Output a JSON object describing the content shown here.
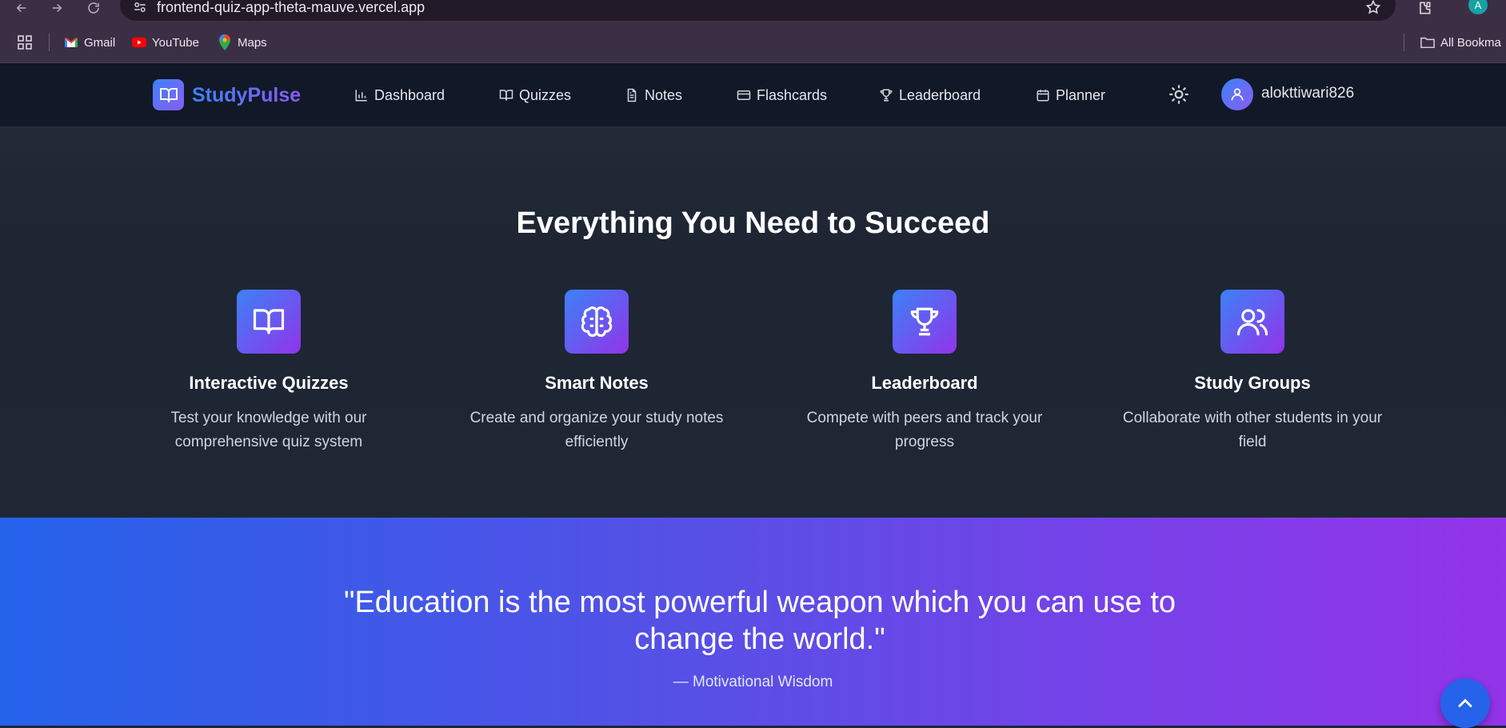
{
  "browser": {
    "url": "frontend-quiz-app-theta-mauve.vercel.app",
    "profile_initial": "A",
    "bookmarks": [
      {
        "label": "Gmail",
        "icon": "gmail-icon"
      },
      {
        "label": "YouTube",
        "icon": "youtube-icon"
      },
      {
        "label": "Maps",
        "icon": "maps-icon"
      }
    ],
    "all_bookmarks_label": "All Bookma"
  },
  "navbar": {
    "brand": "StudyPulse",
    "items": [
      {
        "label": "Dashboard",
        "icon": "bar-chart-icon"
      },
      {
        "label": "Quizzes",
        "icon": "open-book-icon"
      },
      {
        "label": "Notes",
        "icon": "file-text-icon"
      },
      {
        "label": "Flashcards",
        "icon": "credit-card-icon"
      },
      {
        "label": "Leaderboard",
        "icon": "trophy-icon"
      },
      {
        "label": "Planner",
        "icon": "calendar-icon"
      }
    ],
    "theme_icon": "sun-icon",
    "username": "alokttiwari826"
  },
  "features": {
    "title": "Everything You Need to Succeed",
    "items": [
      {
        "title": "Interactive Quizzes",
        "desc": "Test your knowledge with our comprehensive quiz system",
        "icon": "open-book-icon"
      },
      {
        "title": "Smart Notes",
        "desc": "Create and organize your study notes efficiently",
        "icon": "brain-icon"
      },
      {
        "title": "Leaderboard",
        "desc": "Compete with peers and track your progress",
        "icon": "trophy-icon"
      },
      {
        "title": "Study Groups",
        "desc": "Collaborate with other students in your field",
        "icon": "users-icon"
      }
    ]
  },
  "quote": {
    "text": "\"Education is the most powerful weapon which you can use to change the world.\"",
    "author": "— Motivational Wisdom"
  },
  "colors": {
    "navbar_bg": "#111827",
    "section_bg": "#1e2634",
    "accent_blue": "#3b82f6",
    "accent_purple": "#9333ea"
  }
}
